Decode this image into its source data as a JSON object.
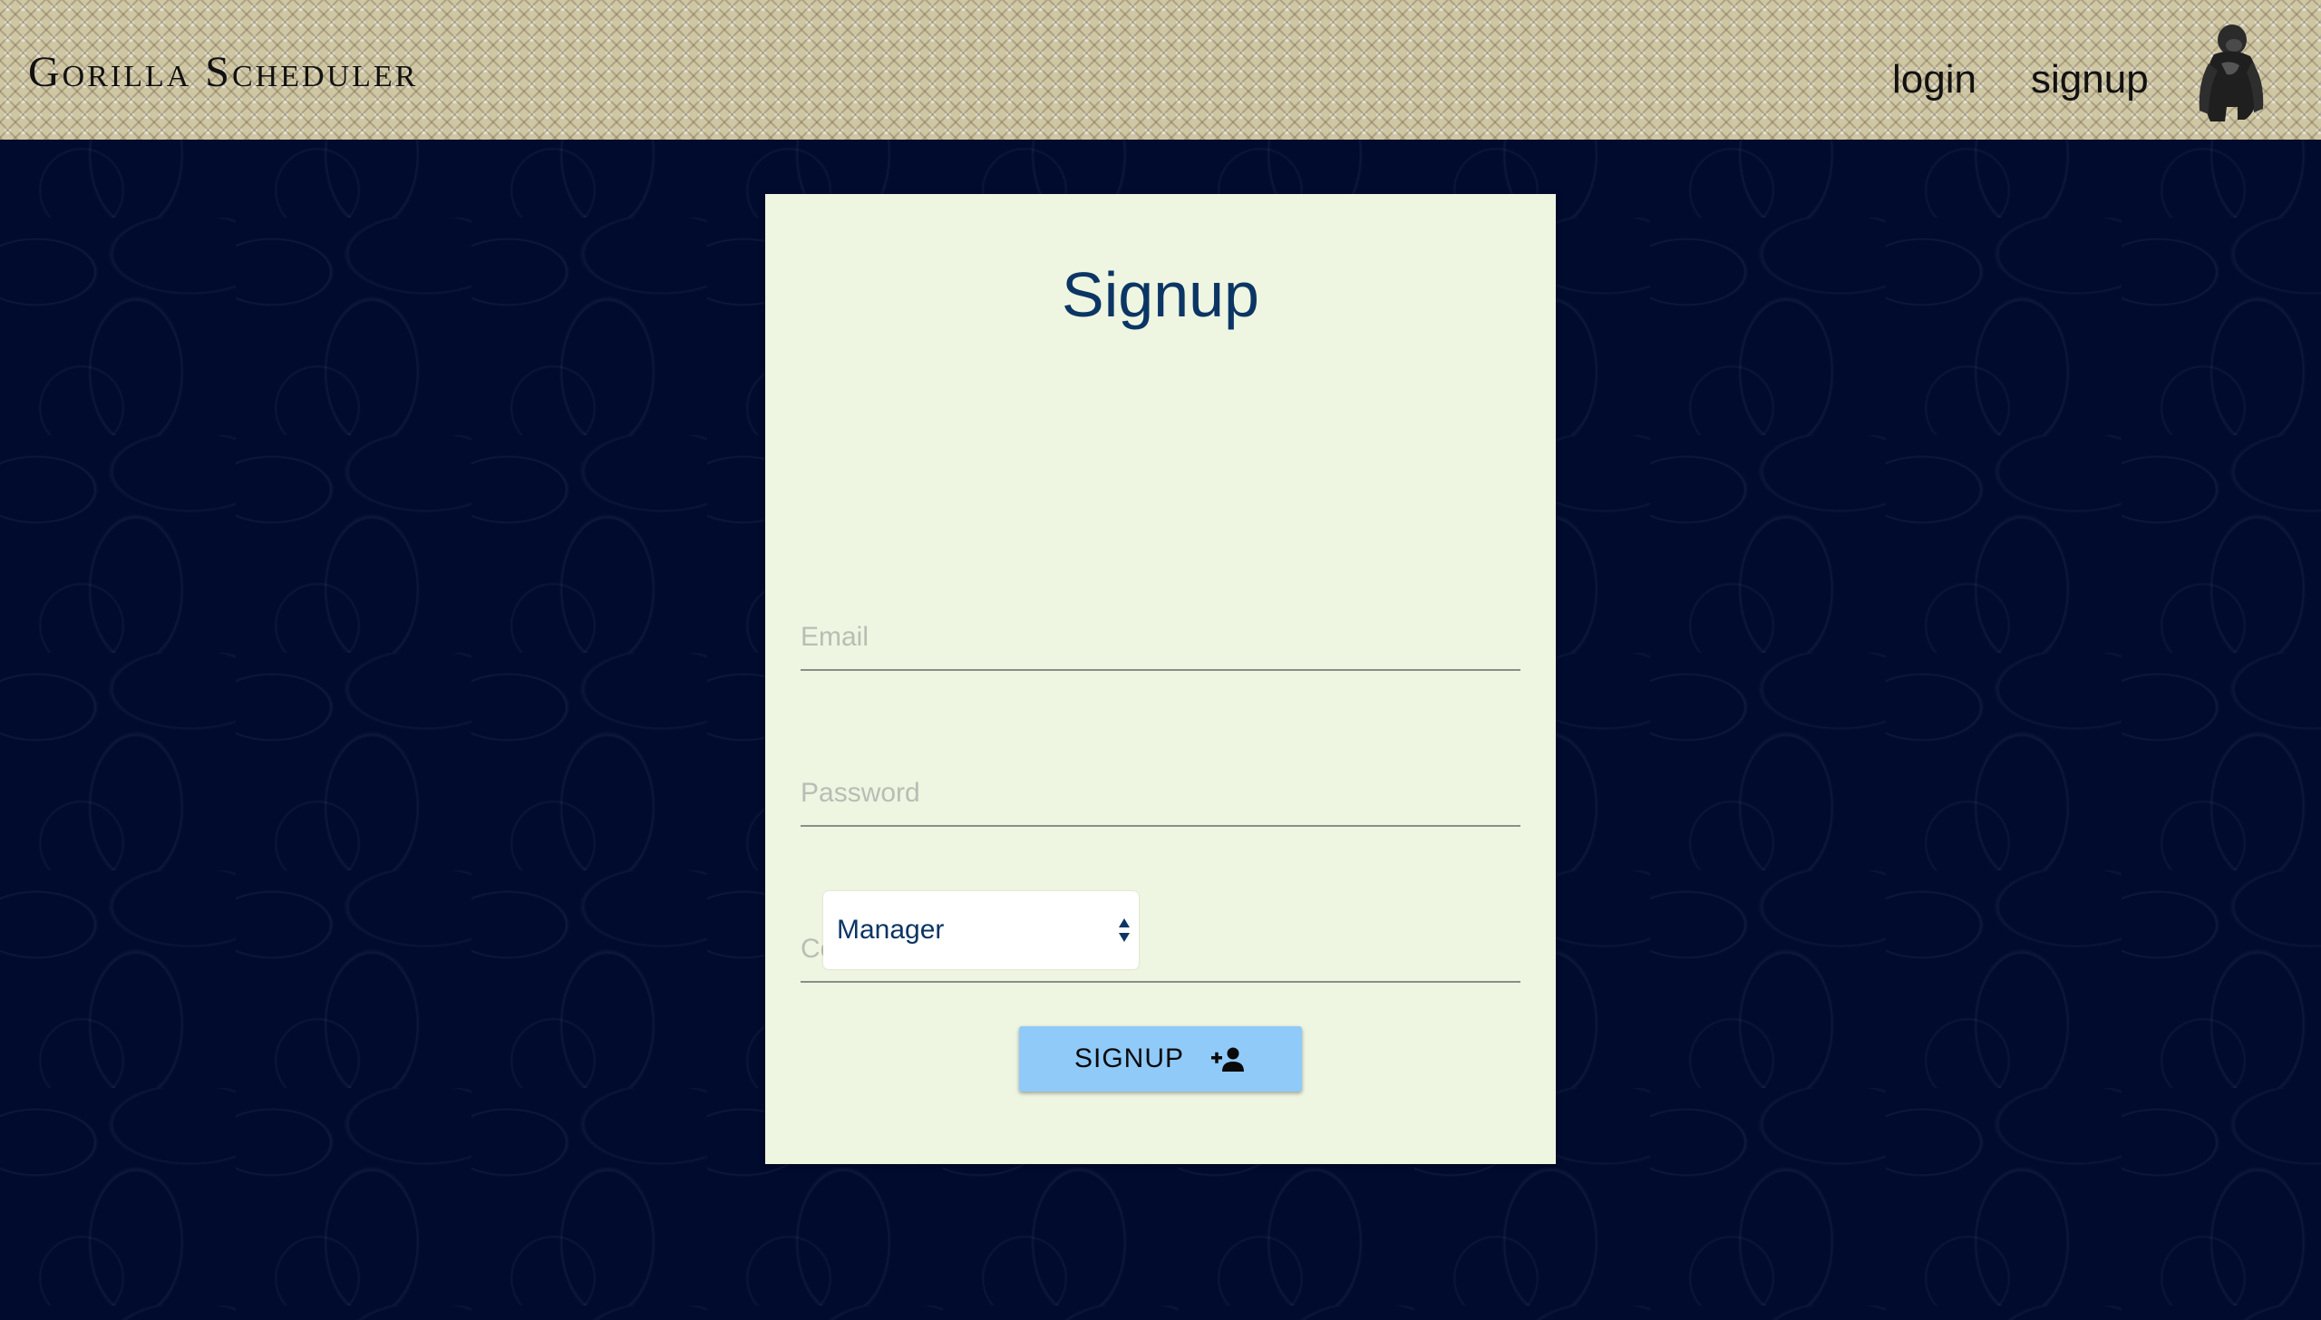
{
  "header": {
    "brand": "Gorilla Scheduler",
    "nav": {
      "login": "login",
      "signup": "signup"
    },
    "logo_icon": "gorilla-icon"
  },
  "form": {
    "title": "Signup",
    "email_placeholder": "Email",
    "password_placeholder": "Password",
    "confirm_password_placeholder": "Confirm Password",
    "role_selected": "Manager",
    "submit_label": "SIGNUP",
    "submit_icon": "person-add-icon"
  },
  "colors": {
    "background": "#010b2e",
    "card": "#eef5e1",
    "title": "#0b3564",
    "button": "#90caf9"
  }
}
